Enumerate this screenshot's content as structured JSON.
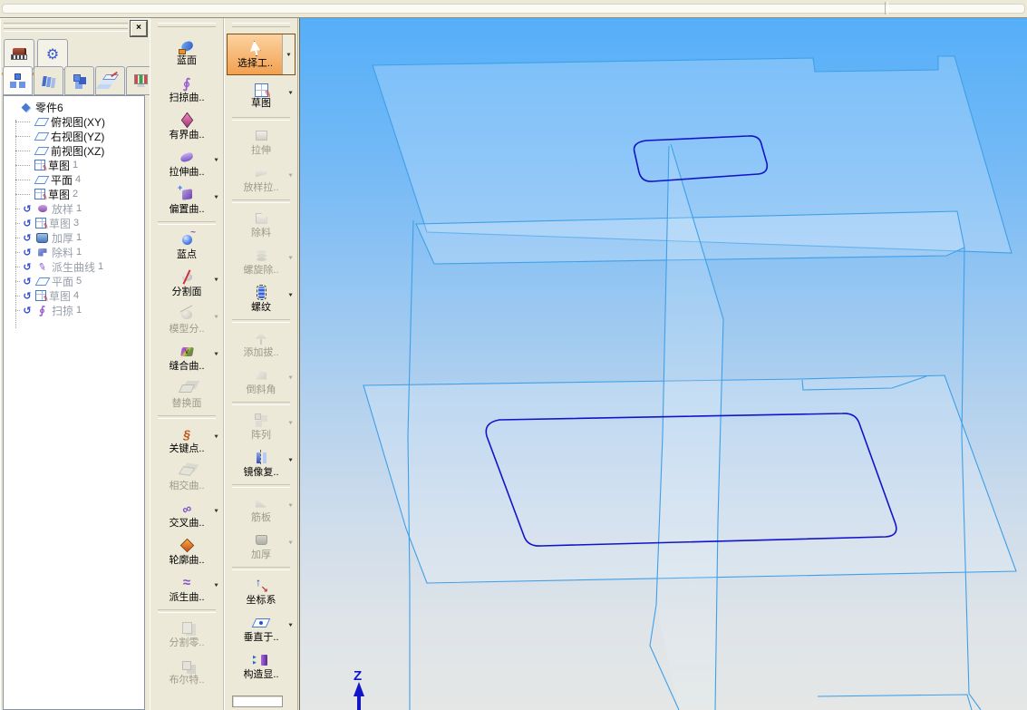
{
  "panel": {
    "close_glyph": "×",
    "buttons": [
      {
        "icon": "camera",
        "active": true
      },
      {
        "icon": "gear"
      }
    ],
    "tabs": [
      {
        "icon": "tree-view",
        "active": true
      },
      {
        "icon": "library"
      },
      {
        "icon": "blocks"
      },
      {
        "icon": "layers"
      },
      {
        "icon": "render"
      }
    ],
    "tree": {
      "root_label": "零件6",
      "items": [
        {
          "name": "俯视图(XY)",
          "num": "",
          "icon": "plane"
        },
        {
          "name": "右视图(YZ)",
          "num": "",
          "icon": "plane"
        },
        {
          "name": "前视图(XZ)",
          "num": "",
          "icon": "plane"
        },
        {
          "name": "草图",
          "num": "1",
          "icon": "sketch"
        },
        {
          "name": "平面",
          "num": "4",
          "icon": "plane"
        },
        {
          "name": "草图",
          "num": "2",
          "icon": "sketch"
        },
        {
          "name": "放样",
          "num": "1",
          "icon": "loft",
          "suppressed": true
        },
        {
          "name": "草图",
          "num": "3",
          "icon": "sketch",
          "suppressed": true
        },
        {
          "name": "加厚",
          "num": "1",
          "icon": "thicken",
          "suppressed": true
        },
        {
          "name": "除料",
          "num": "1",
          "icon": "cut",
          "suppressed": true
        },
        {
          "name": "派生曲线",
          "num": "1",
          "icon": "derived-curve",
          "suppressed": true
        },
        {
          "name": "平面",
          "num": "5",
          "icon": "plane",
          "suppressed": true
        },
        {
          "name": "草图",
          "num": "4",
          "icon": "sketch",
          "suppressed": true
        },
        {
          "name": "扫掠",
          "num": "1",
          "icon": "sweep",
          "suppressed": true
        }
      ]
    }
  },
  "toolbar_surface": {
    "items": [
      {
        "label": "蓝面",
        "icon": "blue-face"
      },
      {
        "label": "扫掠曲..",
        "icon": "sweep-surface"
      },
      {
        "label": "有界曲..",
        "icon": "bounded-surface"
      },
      {
        "label": "拉伸曲..",
        "icon": "extrude-surface",
        "arrow": true
      },
      {
        "label": "偏置曲..",
        "icon": "offset-surface",
        "arrow": true
      },
      {
        "sep": true
      },
      {
        "label": "蓝点",
        "icon": "blue-point"
      },
      {
        "label": "分割面",
        "icon": "split-face",
        "arrow": true
      },
      {
        "label": "模型分..",
        "icon": "model-split",
        "disabled": true,
        "arrow": true
      },
      {
        "label": "缝合曲..",
        "icon": "sew-surface",
        "arrow": true
      },
      {
        "label": "替换面",
        "icon": "replace-face",
        "disabled": true
      },
      {
        "sep": true
      },
      {
        "label": "关键点..",
        "icon": "keypoint-curve",
        "arrow": true
      },
      {
        "label": "相交曲..",
        "icon": "intersect-curve",
        "disabled": true
      },
      {
        "label": "交叉曲..",
        "icon": "cross-curve",
        "arrow": true
      },
      {
        "label": "轮廓曲..",
        "icon": "contour-curve"
      },
      {
        "label": "派生曲..",
        "icon": "derived-curve",
        "arrow": true
      },
      {
        "sep": true
      },
      {
        "label": "分割零..",
        "icon": "split-part",
        "disabled": true
      },
      {
        "label": "布尔特..",
        "icon": "boolean-feature",
        "disabled": true
      }
    ]
  },
  "toolbar_feature": {
    "items": [
      {
        "label": "选择工..",
        "icon": "select-cursor",
        "active": true
      },
      {
        "label": "草图",
        "icon": "sketch",
        "arrow": true
      },
      {
        "sep": true
      },
      {
        "label": "拉伸",
        "icon": "extrude",
        "disabled": true
      },
      {
        "label": "放样拉..",
        "icon": "loft-extrude",
        "disabled": true,
        "arrow": true
      },
      {
        "sep": true
      },
      {
        "label": "除料",
        "icon": "cutout",
        "disabled": true
      },
      {
        "label": "螺旋除..",
        "icon": "helix-cut",
        "disabled": true,
        "arrow": true
      },
      {
        "label": "螺纹",
        "icon": "thread",
        "arrow": true
      },
      {
        "sep": true
      },
      {
        "label": "添加拔..",
        "icon": "add-draft",
        "disabled": true
      },
      {
        "label": "倒斜角",
        "icon": "chamfer",
        "disabled": true,
        "arrow": true
      },
      {
        "sep": true
      },
      {
        "label": "阵列",
        "icon": "pattern",
        "disabled": true,
        "arrow": true
      },
      {
        "label": "镜像复..",
        "icon": "mirror-copy",
        "arrow": true
      },
      {
        "sep": true
      },
      {
        "label": "筋板",
        "icon": "rib",
        "disabled": true,
        "arrow": true
      },
      {
        "label": "加厚",
        "icon": "thicken",
        "disabled": true,
        "arrow": true
      },
      {
        "sep": true
      },
      {
        "label": "坐标系",
        "icon": "coordinate-system"
      },
      {
        "label": "垂直于..",
        "icon": "normal-to",
        "arrow": true
      },
      {
        "label": "构造显..",
        "icon": "construction-display"
      }
    ]
  },
  "viewport": {
    "axis_label": "Z",
    "colors": {
      "bg_top": "#55aff8",
      "bg_bottom": "#e4e7e5",
      "wireframe": "#3f9fe8",
      "sketch_profile": "#1214c9",
      "active_tool": "#f2a050"
    }
  }
}
